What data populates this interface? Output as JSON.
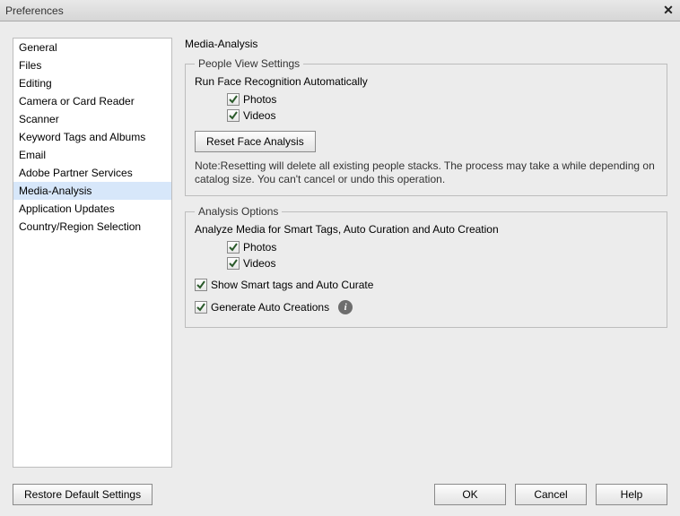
{
  "window": {
    "title": "Preferences"
  },
  "sidebar": {
    "items": [
      {
        "label": "General"
      },
      {
        "label": "Files"
      },
      {
        "label": "Editing"
      },
      {
        "label": "Camera or Card Reader"
      },
      {
        "label": "Scanner"
      },
      {
        "label": "Keyword Tags and Albums"
      },
      {
        "label": "Email"
      },
      {
        "label": "Adobe Partner Services"
      },
      {
        "label": "Media-Analysis"
      },
      {
        "label": "Application Updates"
      },
      {
        "label": "Country/Region Selection"
      }
    ],
    "selected_index": 8
  },
  "main": {
    "title": "Media-Analysis",
    "people_view": {
      "legend": "People View Settings",
      "subhead": "Run Face Recognition Automatically",
      "photos_label": "Photos",
      "photos_checked": true,
      "videos_label": "Videos",
      "videos_checked": true,
      "reset_button": "Reset Face Analysis",
      "note": "Note:Resetting will delete all existing people stacks. The process may take a while depending on catalog size. You can't cancel or undo this operation."
    },
    "analysis_options": {
      "legend": "Analysis Options",
      "subhead": "Analyze Media for Smart Tags, Auto Curation and Auto Creation",
      "photos_label": "Photos",
      "photos_checked": true,
      "videos_label": "Videos",
      "videos_checked": true,
      "show_smart_label": "Show Smart tags and Auto Curate",
      "show_smart_checked": true,
      "gen_auto_label": "Generate Auto Creations",
      "gen_auto_checked": true
    }
  },
  "footer": {
    "restore": "Restore Default Settings",
    "ok": "OK",
    "cancel": "Cancel",
    "help": "Help"
  }
}
